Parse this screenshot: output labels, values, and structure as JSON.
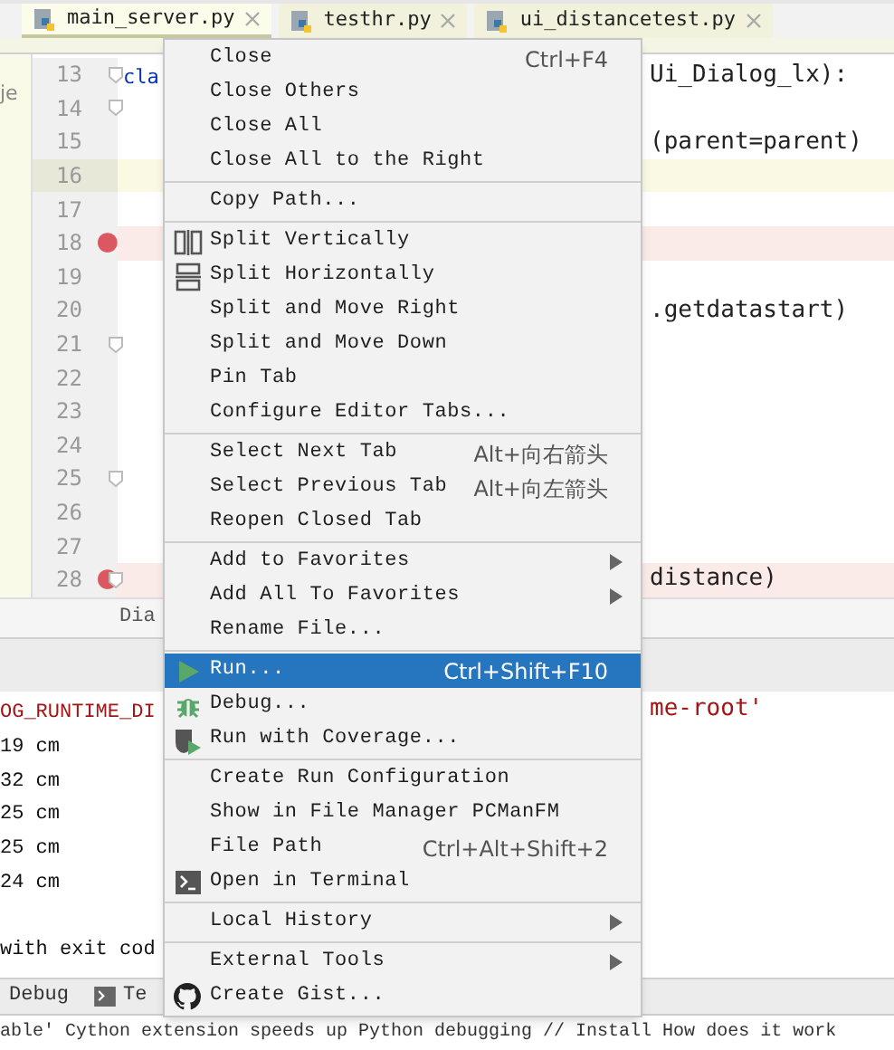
{
  "tabs": [
    {
      "label": "main_server.py",
      "selected": true
    },
    {
      "label": "testhr.py",
      "selected": false
    },
    {
      "label": "ui_distancetest.py",
      "selected": false
    }
  ],
  "project_panel_text": "je",
  "editor_lines": [
    {
      "number": "13",
      "breakpoint": false,
      "current": false,
      "fold": true,
      "code_left": "cla",
      "code_right": "Ui_Dialog_lx):"
    },
    {
      "number": "14",
      "breakpoint": false,
      "current": false,
      "fold": true
    },
    {
      "number": "15",
      "breakpoint": false,
      "current": false,
      "fold": false,
      "code_right": "(parent=parent)"
    },
    {
      "number": "16",
      "breakpoint": false,
      "current": true,
      "fold": false
    },
    {
      "number": "17",
      "breakpoint": false,
      "current": false,
      "fold": false
    },
    {
      "number": "18",
      "breakpoint": true,
      "current": false,
      "fold": false
    },
    {
      "number": "19",
      "breakpoint": false,
      "current": false,
      "fold": false
    },
    {
      "number": "20",
      "breakpoint": false,
      "current": false,
      "fold": false,
      "code_right": ".getdatastart)"
    },
    {
      "number": "21",
      "breakpoint": false,
      "current": false,
      "fold": true
    },
    {
      "number": "22",
      "breakpoint": false,
      "current": false,
      "fold": false
    },
    {
      "number": "23",
      "breakpoint": false,
      "current": false,
      "fold": false
    },
    {
      "number": "24",
      "breakpoint": false,
      "current": false,
      "fold": false
    },
    {
      "number": "25",
      "breakpoint": false,
      "current": false,
      "fold": true
    },
    {
      "number": "26",
      "breakpoint": false,
      "current": false,
      "fold": false
    },
    {
      "number": "27",
      "breakpoint": false,
      "current": false,
      "fold": false
    },
    {
      "number": "28",
      "breakpoint": true,
      "current": false,
      "fold": true,
      "code_right": "distance)"
    }
  ],
  "breadcrumb": "Dia",
  "console_lines": [
    {
      "left": "OG_RUNTIME_DI",
      "right": "me-root'",
      "kind": "error"
    },
    {
      "left": "19 cm",
      "kind": "output"
    },
    {
      "left": "32 cm",
      "kind": "output"
    },
    {
      "left": "25 cm",
      "kind": "output"
    },
    {
      "left": "25 cm",
      "kind": "output"
    },
    {
      "left": "24 cm",
      "kind": "output"
    },
    {
      "kind": "blank"
    },
    {
      "left": "with exit cod",
      "kind": "output"
    }
  ],
  "tool_tabs": [
    {
      "label": "Debug",
      "kind": "debug"
    },
    {
      "label": "Te",
      "kind": "terminal"
    }
  ],
  "status_text": "able' Cython extension speeds up Python debugging // Install   How does it work",
  "context_menu": [
    [
      {
        "label": "Close",
        "shortcut": "Ctrl+F4",
        "kind": "plain",
        "selected": false
      },
      {
        "label": "Close Others",
        "kind": "plain",
        "selected": false
      },
      {
        "label": "Close All",
        "kind": "plain",
        "selected": false
      },
      {
        "label": "Close All to the Right",
        "kind": "plain",
        "selected": false
      }
    ],
    [
      {
        "label": "Copy Path...",
        "kind": "plain",
        "selected": false
      }
    ],
    [
      {
        "label": "Split Vertically",
        "kind": "split-vertical",
        "selected": false
      },
      {
        "label": "Split Horizontally",
        "kind": "split-horizontal",
        "selected": false
      },
      {
        "label": "Split and Move Right",
        "kind": "plain",
        "selected": false
      },
      {
        "label": "Split and Move Down",
        "kind": "plain",
        "selected": false
      },
      {
        "label": "Pin Tab",
        "kind": "plain",
        "selected": false
      },
      {
        "label": "Configure Editor Tabs...",
        "kind": "plain",
        "selected": false
      }
    ],
    [
      {
        "label": "Select Next Tab",
        "shortcut": "Alt+向右箭头",
        "kind": "plain",
        "selected": false
      },
      {
        "label": "Select Previous Tab",
        "shortcut": "Alt+向左箭头",
        "kind": "plain",
        "selected": false
      },
      {
        "label": "Reopen Closed Tab",
        "kind": "plain",
        "selected": false
      }
    ],
    [
      {
        "label": "Add to Favorites",
        "kind": "submenu",
        "selected": false
      },
      {
        "label": "Add All To Favorites",
        "kind": "submenu",
        "selected": false
      },
      {
        "label": "Rename File...",
        "kind": "plain",
        "selected": false
      }
    ],
    [
      {
        "label": "Run...",
        "shortcut": "Ctrl+Shift+F10",
        "kind": "run",
        "selected": true
      },
      {
        "label": "Debug...",
        "kind": "debug",
        "selected": false
      },
      {
        "label": "Run with Coverage...",
        "kind": "coverage",
        "selected": false
      }
    ],
    [
      {
        "label": "Create Run Configuration",
        "kind": "plain",
        "selected": false
      },
      {
        "label": "Show in File Manager PCManFM",
        "kind": "plain",
        "selected": false
      },
      {
        "label": "File Path",
        "shortcut": "Ctrl+Alt+Shift+2",
        "kind": "plain",
        "selected": false
      },
      {
        "label": "Open in Terminal",
        "kind": "terminal",
        "selected": false
      }
    ],
    [
      {
        "label": "Local History",
        "kind": "submenu",
        "selected": false
      }
    ],
    [
      {
        "label": "External Tools",
        "kind": "submenu",
        "selected": false
      },
      {
        "label": "Create Gist...",
        "kind": "github",
        "selected": false
      }
    ]
  ]
}
